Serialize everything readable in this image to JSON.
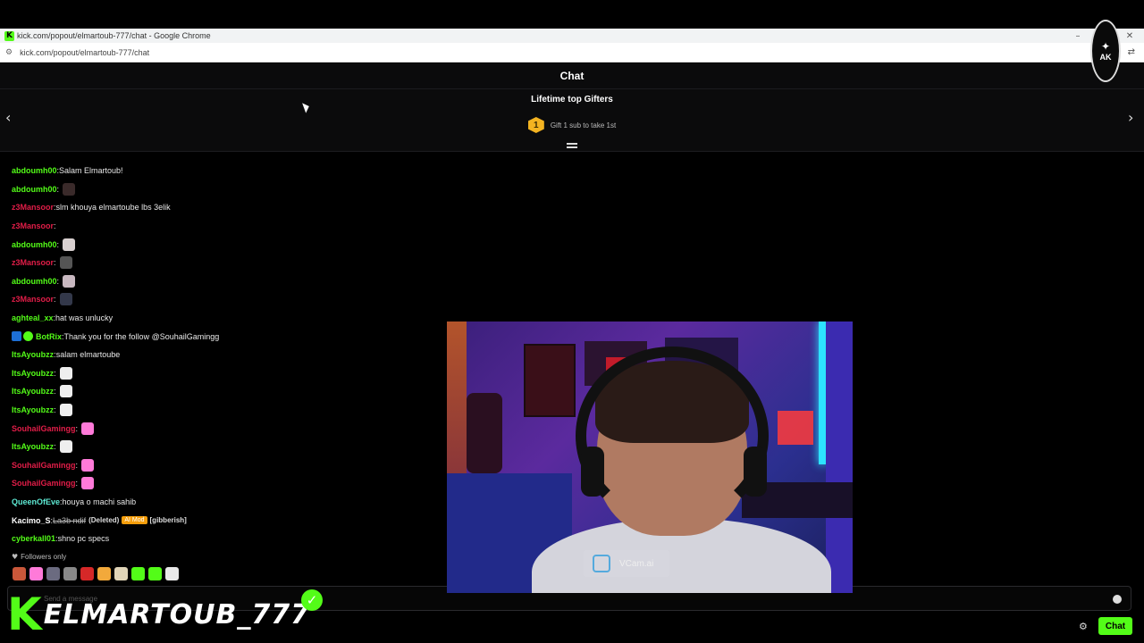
{
  "browser": {
    "window_title": "kick.com/popout/elmartoub-777/chat - Google Chrome",
    "url": "kick.com/popout/elmartoub-777/chat",
    "favicon_letter": "K",
    "minimize": "–",
    "close": "✕"
  },
  "chat": {
    "header_title": "Chat",
    "gifters": {
      "title": "Lifetime top Gifters",
      "rank": "1",
      "hint": "Gift 1 sub to take 1st"
    },
    "messages": [
      {
        "user": "abdoumh00",
        "color": "#53fc18",
        "text": "Salam Elmartoub!"
      },
      {
        "user": "abdoumh00",
        "color": "#53fc18",
        "text": "",
        "emote": "#3a2a2a"
      },
      {
        "user": "z3Mansoor",
        "color": "#e11d48",
        "text": "slm khouya elmartoube lbs 3elik"
      },
      {
        "user": "z3Mansoor",
        "color": "#e11d48",
        "text": ""
      },
      {
        "user": "abdoumh00",
        "color": "#53fc18",
        "text": "",
        "emote": "#d8d0d0"
      },
      {
        "user": "z3Mansoor",
        "color": "#e11d48",
        "text": "",
        "emote": "#555555"
      },
      {
        "user": "abdoumh00",
        "color": "#53fc18",
        "text": "",
        "emote": "#c8b8c0"
      },
      {
        "user": "z3Mansoor",
        "color": "#e11d48",
        "text": "",
        "emote": "#33384a"
      },
      {
        "user": "aghteal_xx",
        "color": "#53fc18",
        "text": "hat was unlucky"
      },
      {
        "user": "BotRix",
        "color": "#53fc18",
        "text": "Thank you for the follow @SouhailGamingg",
        "badges": true
      },
      {
        "user": "ItsAyoubzz",
        "color": "#53fc18",
        "text": "salam elmartoube"
      },
      {
        "user": "ItsAyoubzz",
        "color": "#53fc18",
        "text": "",
        "emote": "#eeeeee"
      },
      {
        "user": "ItsAyoubzz",
        "color": "#53fc18",
        "text": "",
        "emote": "#eeeeee"
      },
      {
        "user": "ItsAyoubzz",
        "color": "#53fc18",
        "text": "",
        "emote": "#eeeeee"
      },
      {
        "user": "SouhailGamingg",
        "color": "#e11d48",
        "text": "",
        "emote": "#ff7ad9"
      },
      {
        "user": "ItsAyoubzz",
        "color": "#53fc18",
        "text": "",
        "emote": "#eeeeee"
      },
      {
        "user": "SouhailGamingg",
        "color": "#e11d48",
        "text": "",
        "emote": "#ff7ad9"
      },
      {
        "user": "SouhailGamingg",
        "color": "#e11d48",
        "text": "",
        "emote": "#ff7ad9"
      },
      {
        "user": "QueenOfEve",
        "color": "#5eead4",
        "text": "houya o machi sahib"
      },
      {
        "user": "Kacimo_S",
        "color": "#ffffff",
        "text": "",
        "deleted_text": "La3b ndif",
        "deleted_label": "(Deleted)",
        "ai_mod": "AI Mod",
        "gibberish": "[gibberish]"
      },
      {
        "user": "cyberkall01",
        "color": "#53fc18",
        "text": "shno pc specs"
      }
    ],
    "followers_only": "Followers only",
    "emote_bar": [
      "#c9573a",
      "#ff7ad9",
      "#6b6b80",
      "#888888",
      "#d62828",
      "#f2a93b",
      "#e0d4b8",
      "#53fc18",
      "#53fc18",
      "#e8e8e8"
    ],
    "input_placeholder": "Send a message",
    "chat_button": "Chat"
  },
  "overlay": {
    "webcam_watermark": "VCam.ai",
    "brand_k": "K",
    "brand_name": "ELMARTOUB_777",
    "ak_logo_text": "AK"
  },
  "colors": {
    "kick_green": "#53fc18",
    "background": "#000000"
  }
}
